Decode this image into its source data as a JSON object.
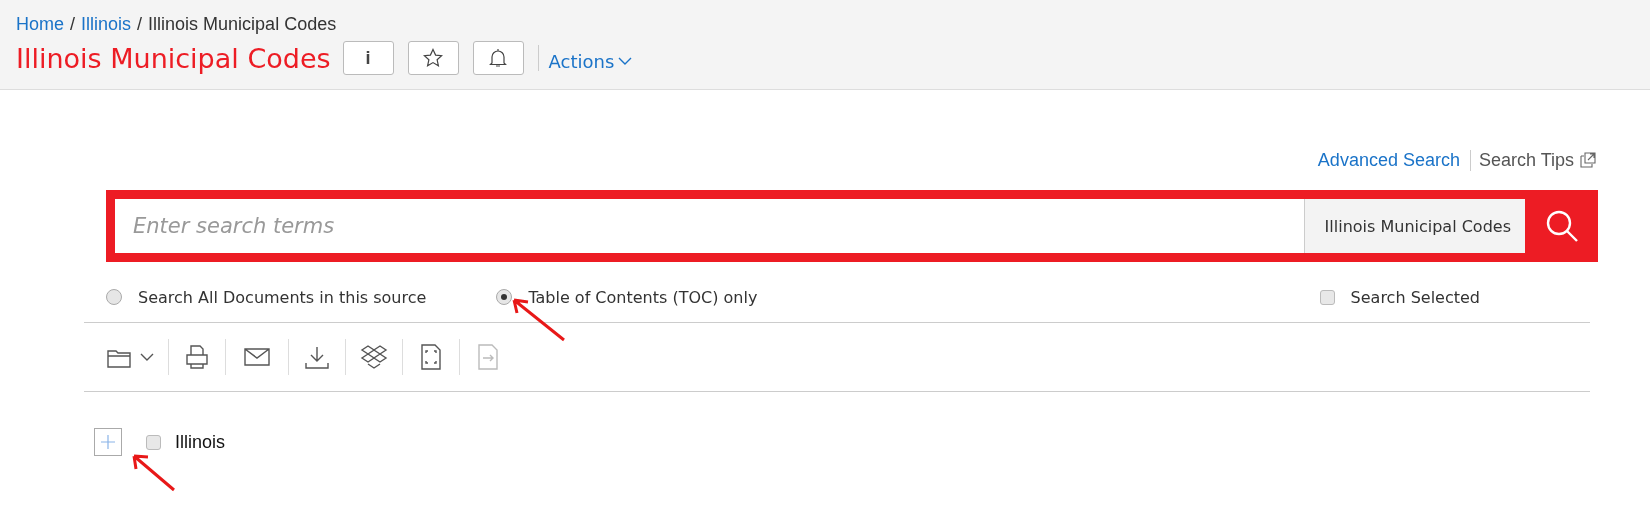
{
  "breadcrumb": [
    {
      "label": "Home",
      "link": true
    },
    {
      "label": "Illinois",
      "link": true
    },
    {
      "label": "Illinois Municipal Codes",
      "link": false
    }
  ],
  "separator": "/",
  "title": "Illinois Municipal Codes",
  "header_buttons": [
    {
      "kind": "info",
      "label": "i"
    },
    {
      "kind": "star"
    },
    {
      "kind": "bell"
    }
  ],
  "actions": "Actions",
  "search_links": {
    "advanced": "Advanced Search",
    "tips": "Search Tips"
  },
  "search": {
    "placeholder": "Enter search terms",
    "scope": "Illinois Municipal Codes"
  },
  "scope_options": [
    {
      "label": "Search All Documents in this source",
      "selected": false
    },
    {
      "label": "Table of Contents (TOC) only",
      "selected": true
    }
  ],
  "search_selected": {
    "label": "Search Selected",
    "checked": false
  },
  "toolbar": [
    {
      "kind": "folder",
      "disabled": false
    },
    {
      "kind": "print",
      "disabled": false
    },
    {
      "kind": "mail",
      "disabled": false
    },
    {
      "kind": "download",
      "disabled": false
    },
    {
      "kind": "dropbox",
      "disabled": false
    },
    {
      "kind": "frame",
      "disabled": false
    },
    {
      "kind": "export",
      "disabled": true
    }
  ],
  "tree": [
    {
      "label": "Illinois",
      "expanded": false,
      "checked": false
    }
  ]
}
